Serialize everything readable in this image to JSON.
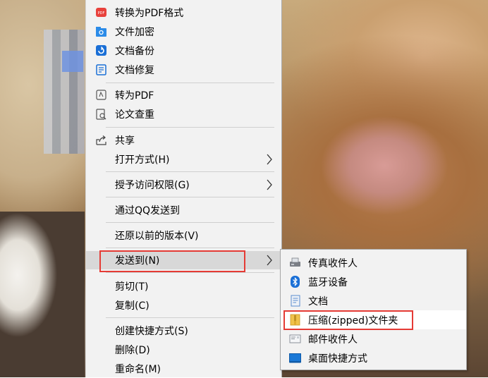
{
  "context_menu": {
    "items": [
      {
        "label": "转换为PDF格式",
        "icon": "pdf-convert-icon"
      },
      {
        "label": "文件加密",
        "icon": "file-encrypt-icon"
      },
      {
        "label": "文档备份",
        "icon": "backup-icon"
      },
      {
        "label": "文档修复",
        "icon": "repair-icon"
      },
      {
        "label": "转为PDF",
        "icon": "to-pdf-icon"
      },
      {
        "label": "论文查重",
        "icon": "plagiarism-check-icon"
      },
      {
        "label": "共享",
        "icon": "share-icon"
      },
      {
        "label": "打开方式(H)",
        "icon": ""
      },
      {
        "label": "授予访问权限(G)",
        "icon": ""
      },
      {
        "label": "通过QQ发送到",
        "icon": ""
      },
      {
        "label": "还原以前的版本(V)",
        "icon": ""
      },
      {
        "label": "发送到(N)",
        "icon": ""
      },
      {
        "label": "剪切(T)",
        "icon": ""
      },
      {
        "label": "复制(C)",
        "icon": ""
      },
      {
        "label": "创建快捷方式(S)",
        "icon": ""
      },
      {
        "label": "删除(D)",
        "icon": ""
      },
      {
        "label": "重命名(M)",
        "icon": ""
      }
    ]
  },
  "send_to_submenu": {
    "items": [
      {
        "label": "传真收件人",
        "icon": "fax-icon"
      },
      {
        "label": "蓝牙设备",
        "icon": "bluetooth-icon"
      },
      {
        "label": "文档",
        "icon": "documents-icon"
      },
      {
        "label": "压缩(zipped)文件夹",
        "icon": "zip-folder-icon"
      },
      {
        "label": "邮件收件人",
        "icon": "mail-icon"
      },
      {
        "label": "桌面快捷方式",
        "icon": "desktop-icon"
      }
    ]
  },
  "colors": {
    "menu_bg": "#f2f2f2",
    "highlight_box": "#e53b35",
    "pdf_icon": "#e8413c",
    "accent_blue": "#1a6fd6"
  }
}
